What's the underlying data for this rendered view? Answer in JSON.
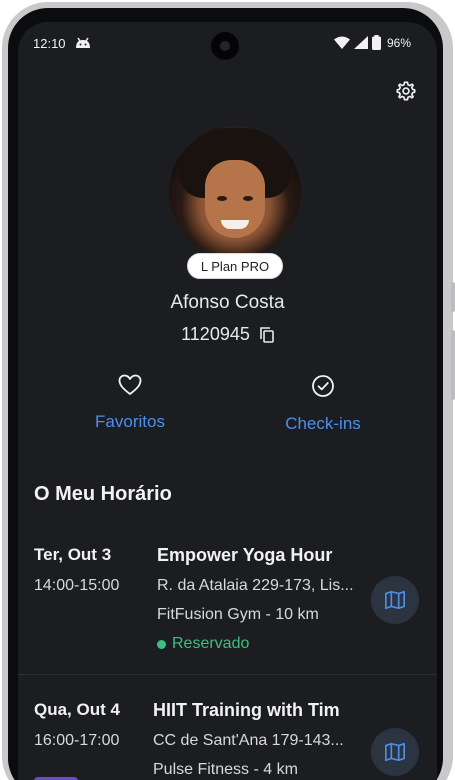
{
  "status_bar": {
    "time": "12:10",
    "battery": "96%"
  },
  "profile": {
    "plan_badge": "L Plan PRO",
    "name": "Afonso Costa",
    "member_id": "1120945"
  },
  "actions": [
    {
      "label": "Favoritos",
      "icon": "heart-outline-icon"
    },
    {
      "label": "Check-ins",
      "icon": "check-circle-icon"
    }
  ],
  "schedule": {
    "title": "O Meu Horário",
    "events": [
      {
        "date": "Ter, Out 3",
        "time": "14:00-15:00",
        "title": "Empower Yoga Hour",
        "address": "R. da Atalaia 229-173, Lis...",
        "gym": "FitFusion Gym - 10 km",
        "status": "Reservado"
      },
      {
        "date": "Qua, Out 4",
        "time": "16:00-17:00",
        "title": "HIIT Training with Tim",
        "address": "CC de Sant'Ana 179-143...",
        "gym": "Pulse Fitness - 4 km"
      }
    ]
  },
  "colors": {
    "accent": "#4f8fe8",
    "status_green": "#3fbf7f",
    "background": "#1b1d21"
  }
}
